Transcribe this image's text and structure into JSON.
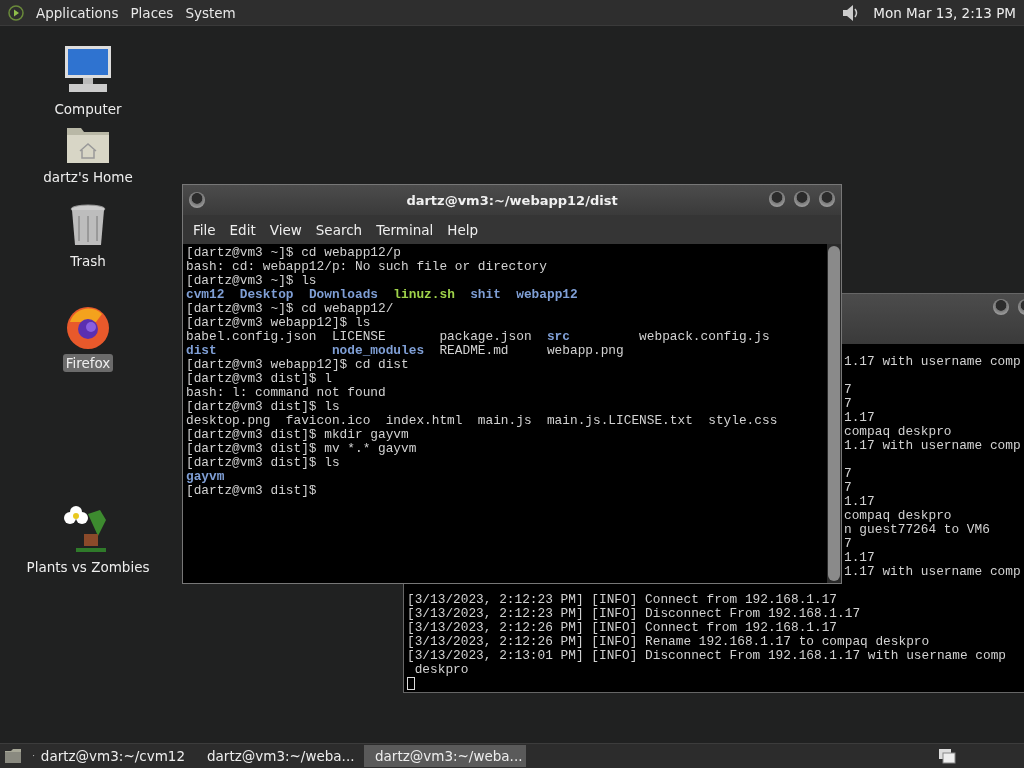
{
  "top_panel": {
    "menus": [
      "Applications",
      "Places",
      "System"
    ],
    "clock": "Mon Mar 13, 2:13 PM"
  },
  "desktop_icons": [
    {
      "label": "Computer",
      "kind": "computer",
      "selected": false
    },
    {
      "label": "dartz's Home",
      "kind": "home",
      "selected": false
    },
    {
      "label": "Trash",
      "kind": "trash",
      "selected": false
    },
    {
      "label": "Firefox",
      "kind": "browser",
      "selected": true
    },
    {
      "label": "Plants vs Zombies",
      "kind": "game",
      "selected": false
    }
  ],
  "back_terminal": {
    "line_end_groups": [
      [
        "1.17 with username comp"
      ],
      [
        "7",
        "7",
        "1.17",
        "compaq deskpro",
        "1.17 with username comp"
      ],
      [
        "7",
        "7",
        "1.17",
        "compaq deskpro",
        "n guest77264 to VM6",
        "7",
        "1.17",
        "1.17 with username comp"
      ]
    ],
    "lines": [
      "[3/13/2023, 2:12:23 PM] [INFO] Connect from 192.168.1.17",
      "[3/13/2023, 2:12:23 PM] [INFO] Disconnect From 192.168.1.17",
      "[3/13/2023, 2:12:26 PM] [INFO] Connect from 192.168.1.17",
      "[3/13/2023, 2:12:26 PM] [INFO] Rename 192.168.1.17 to compaq deskpro",
      "[3/13/2023, 2:13:01 PM] [INFO] Disconnect From 192.168.1.17 with username comp",
      " deskpro"
    ]
  },
  "front_terminal": {
    "title": "dartz@vm3:~/webapp12/dist",
    "menu": [
      "File",
      "Edit",
      "View",
      "Search",
      "Terminal",
      "Help"
    ],
    "lines": [
      [
        {
          "text": "[dartz@vm3 ~]$ cd webapp12/p",
          "kind": "plain"
        }
      ],
      [
        {
          "text": "bash: cd: webapp12/p: No such file or directory",
          "kind": "plain"
        }
      ],
      [
        {
          "text": "[dartz@vm3 ~]$ ls",
          "kind": "plain"
        }
      ],
      [
        {
          "text": "cvm12",
          "kind": "dir"
        },
        {
          "text": "  Desktop",
          "kind": "dir"
        },
        {
          "text": "  Downloads",
          "kind": "dir"
        },
        {
          "text": "  linuz.sh",
          "kind": "exec"
        },
        {
          "text": "  shit",
          "kind": "dir"
        },
        {
          "text": "  webapp12",
          "kind": "dir"
        }
      ],
      [
        {
          "text": "[dartz@vm3 ~]$ cd webapp12/",
          "kind": "plain"
        }
      ],
      [
        {
          "text": "[dartz@vm3 webapp12]$ ls",
          "kind": "plain"
        }
      ],
      [
        {
          "text": "babel.config.json  LICENSE       package.json  ",
          "kind": "plain"
        },
        {
          "text": "src",
          "kind": "dir"
        },
        {
          "text": "         webpack.config.js",
          "kind": "plain"
        }
      ],
      [
        {
          "text": "dist",
          "kind": "dir"
        },
        {
          "text": "               node_modules",
          "kind": "dir"
        },
        {
          "text": "  README.md     webapp.png",
          "kind": "plain"
        }
      ],
      [
        {
          "text": "[dartz@vm3 webapp12]$ cd dist",
          "kind": "plain"
        }
      ],
      [
        {
          "text": "[dartz@vm3 dist]$ l",
          "kind": "plain"
        }
      ],
      [
        {
          "text": "bash: l: command not found",
          "kind": "plain"
        }
      ],
      [
        {
          "text": "[dartz@vm3 dist]$ ls",
          "kind": "plain"
        }
      ],
      [
        {
          "text": "desktop.png  favicon.ico  index.html  main.js  main.js.LICENSE.txt  style.css",
          "kind": "plain"
        }
      ],
      [
        {
          "text": "[dartz@vm3 dist]$ mkdir gayvm",
          "kind": "plain"
        }
      ],
      [
        {
          "text": "[dartz@vm3 dist]$ mv *.* gayvm",
          "kind": "plain"
        }
      ],
      [
        {
          "text": "[dartz@vm3 dist]$ ls",
          "kind": "plain"
        }
      ],
      [
        {
          "text": "gayvm",
          "kind": "dir"
        }
      ],
      [
        {
          "text": "[dartz@vm3 dist]$",
          "kind": "plain"
        }
      ]
    ]
  },
  "taskbar": {
    "tasks": [
      {
        "label": "dartz@vm3:~/cvm12",
        "selected": false
      },
      {
        "label": "dartz@vm3:~/weba...",
        "selected": false
      },
      {
        "label": "dartz@vm3:~/weba...",
        "selected": true
      }
    ]
  }
}
